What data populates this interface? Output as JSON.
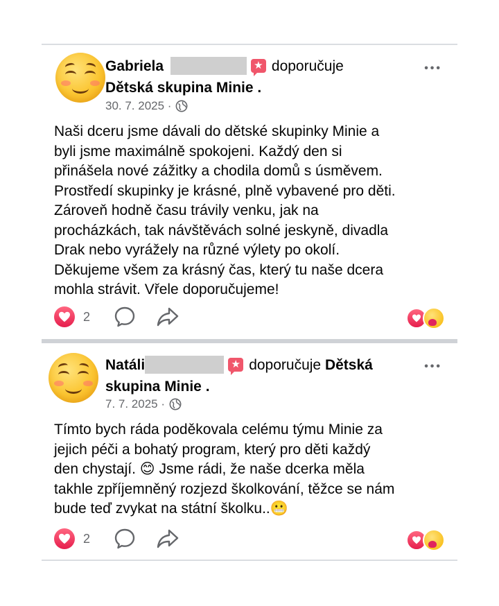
{
  "reviews": [
    {
      "author": "Gabriela",
      "verb": "doporučuje",
      "page": "Dětská skupina Minie",
      "page_suffix": " .",
      "date": "30. 7. 2025 ·",
      "text": "Naši dceru jsme dávali do dětské skupinky Minie a\nbyli jsme maximálně spokojeni. Každý den si\npřinášela nové zážitky a chodila domů s úsměvem.\nProstředí skupinky je krásné, plně vybavené pro děti.\nZároveň hodně času trávily venku, jak na\nprocházkách, tak návštěvách solné jeskyně, divadla\nDrak nebo vyrážely na různé výlety po okolí.\nDěkujeme všem za krásný čas, který tu naše dcera\nmohla strávit. Vřele doporučujeme!",
      "reaction_count": "2"
    },
    {
      "author": "Natáli",
      "verb": "doporučuje",
      "page_part1": "Dětská",
      "page_part2": "skupina Minie",
      "page_suffix": " .",
      "date": "7. 7. 2025 ·",
      "text": "Tímto bych ráda poděkovala celému týmu Minie za\njejich péči a bohatý program, který pro děti každý\nden chystají. 😊 Jsme rádi, že naše dcerka měla\ntakhle zpříjemněný rozjezd školkování, těžce se nám\nbude teď zvykat na státní školku..😬",
      "reaction_count": "2"
    }
  ],
  "icons": {
    "more": "•••",
    "recommend": "★"
  },
  "colors": {
    "love": "#e61e4d",
    "recommend": "#f0566b",
    "secondary_text": "#65676b"
  }
}
